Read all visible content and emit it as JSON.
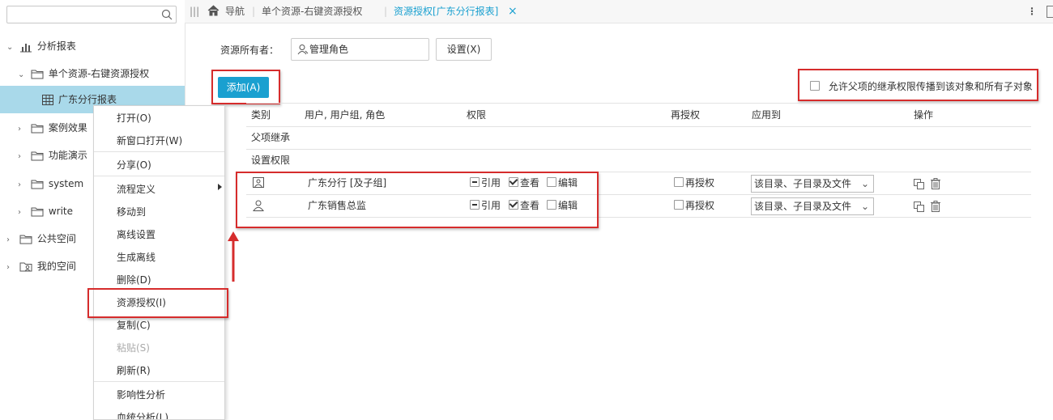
{
  "sidebar": {
    "search_placeholder": "",
    "tree": [
      {
        "label": "分析报表",
        "expanded": true,
        "icon": "chart-icon"
      },
      {
        "label": "单个资源-右键资源授权",
        "expanded": true,
        "icon": "folder-icon"
      },
      {
        "label": "广东分行报表",
        "selected": true,
        "icon": "table-icon"
      },
      {
        "label": "案例效果",
        "icon": "folder-icon"
      },
      {
        "label": "功能演示",
        "icon": "folder-icon"
      },
      {
        "label": "system",
        "icon": "folder-icon"
      },
      {
        "label": "write",
        "icon": "folder-icon"
      },
      {
        "label": "公共空间",
        "icon": "folder-icon"
      },
      {
        "label": "我的空间",
        "icon": "user-folder-icon"
      }
    ]
  },
  "topbar": {
    "nav_label": "导航",
    "crumb": "单个资源-右键资源授权",
    "active_tab": "资源授权[广东分行报表]",
    "close_glyph": "×"
  },
  "owner": {
    "label": "资源所有者：",
    "value": "管理角色",
    "set_button": "设置(X)"
  },
  "add_button": "添加(A)",
  "inherit_checkbox_label": "允许父项的继承权限传播到该对象和所有子对象",
  "table": {
    "headers": [
      "类别",
      "用户, 用户组, 角色",
      "权限",
      "再授权",
      "应用到",
      "操作"
    ],
    "group_inherit": "父项继承",
    "group_set": "设置权限",
    "rows": [
      {
        "type_icon": "user-group-icon",
        "name": "广东分行 [及子组]",
        "perm_ref": "引用",
        "perm_view": "查看",
        "perm_edit": "编辑",
        "regrant": "再授权",
        "apply_to": "该目录、子目录及文件"
      },
      {
        "type_icon": "user-icon",
        "name": "广东销售总监",
        "perm_ref": "引用",
        "perm_view": "查看",
        "perm_edit": "编辑",
        "regrant": "再授权",
        "apply_to": "该目录、子目录及文件"
      }
    ]
  },
  "context_menu": {
    "items": [
      {
        "label": "打开(O)"
      },
      {
        "label": "新窗口打开(W)"
      },
      {
        "label": "分享(O)"
      },
      {
        "label": "流程定义",
        "submenu": true
      },
      {
        "label": "移动到"
      },
      {
        "label": "离线设置"
      },
      {
        "label": "生成离线"
      },
      {
        "label": "删除(D)"
      },
      {
        "label": "资源授权(I)",
        "highlighted": true
      },
      {
        "label": "复制(C)"
      },
      {
        "label": "粘贴(S)",
        "disabled": true
      },
      {
        "label": "刷新(R)"
      },
      {
        "label": "影响性分析"
      },
      {
        "label": "血统分析(L)"
      }
    ]
  },
  "colors": {
    "accent": "#1aa0d0",
    "highlight_box": "#d62c2c",
    "selected_row": "#a9d9ea"
  }
}
